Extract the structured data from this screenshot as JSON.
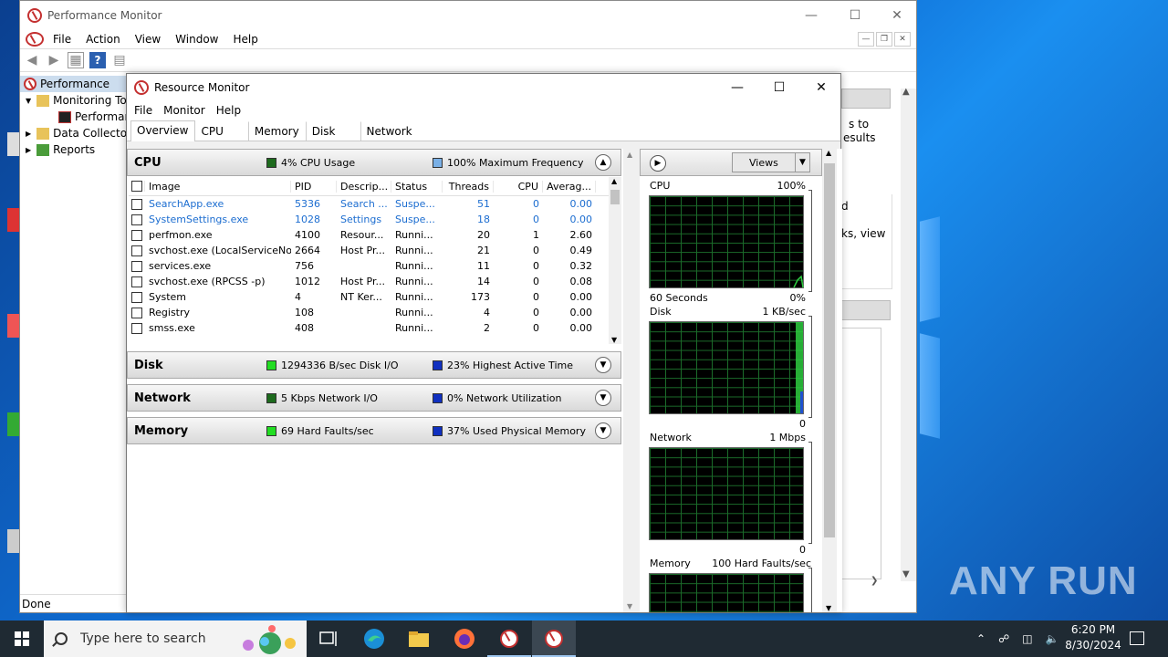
{
  "perfmon": {
    "title": "Performance Monitor",
    "menu": [
      "File",
      "Action",
      "View",
      "Window",
      "Help"
    ],
    "tree": [
      {
        "label": "Performance"
      },
      {
        "label": "Monitoring To"
      },
      {
        "label": "Performan"
      },
      {
        "label": "Data Collecto"
      },
      {
        "label": "Reports"
      }
    ],
    "status": "Done",
    "right_text": [
      "s to",
      "esults",
      "d",
      "ks, view"
    ]
  },
  "resmon": {
    "title": "Resource Monitor",
    "menu": [
      "File",
      "Monitor",
      "Help"
    ],
    "tabs": [
      "Overview",
      "CPU",
      "Memory",
      "Disk",
      "Network"
    ],
    "cpu": {
      "title": "CPU",
      "stat1": "4% CPU Usage",
      "stat1_color": "#1e6b1e",
      "stat2": "100% Maximum Frequency",
      "stat2_color": "#7ab0e6",
      "columns": [
        "Image",
        "PID",
        "Descrip...",
        "Status",
        "Threads",
        "CPU",
        "Averag..."
      ],
      "rows": [
        {
          "image": "SearchApp.exe",
          "pid": "5336",
          "desc": "Search ...",
          "status": "Suspe...",
          "threads": "51",
          "cpu": "0",
          "avg": "0.00"
        },
        {
          "image": "SystemSettings.exe",
          "pid": "1028",
          "desc": "Settings",
          "status": "Suspe...",
          "threads": "18",
          "cpu": "0",
          "avg": "0.00"
        },
        {
          "image": "perfmon.exe",
          "pid": "4100",
          "desc": "Resour...",
          "status": "Runni...",
          "threads": "20",
          "cpu": "1",
          "avg": "2.60"
        },
        {
          "image": "svchost.exe (LocalServiceNo...",
          "pid": "2664",
          "desc": "Host Pr...",
          "status": "Runni...",
          "threads": "21",
          "cpu": "0",
          "avg": "0.49"
        },
        {
          "image": "services.exe",
          "pid": "756",
          "desc": "",
          "status": "Runni...",
          "threads": "11",
          "cpu": "0",
          "avg": "0.32"
        },
        {
          "image": "svchost.exe (RPCSS -p)",
          "pid": "1012",
          "desc": "Host Pr...",
          "status": "Runni...",
          "threads": "14",
          "cpu": "0",
          "avg": "0.08"
        },
        {
          "image": "System",
          "pid": "4",
          "desc": "NT Ker...",
          "status": "Runni...",
          "threads": "173",
          "cpu": "0",
          "avg": "0.00"
        },
        {
          "image": "Registry",
          "pid": "108",
          "desc": "",
          "status": "Runni...",
          "threads": "4",
          "cpu": "0",
          "avg": "0.00"
        },
        {
          "image": "smss.exe",
          "pid": "408",
          "desc": "",
          "status": "Runni...",
          "threads": "2",
          "cpu": "0",
          "avg": "0.00"
        }
      ]
    },
    "disk": {
      "title": "Disk",
      "stat1": "1294336 B/sec Disk I/O",
      "stat1_color": "#22dd22",
      "stat2": "23% Highest Active Time",
      "stat2_color": "#1030c0"
    },
    "network": {
      "title": "Network",
      "stat1": "5 Kbps Network I/O",
      "stat1_color": "#1e6b1e",
      "stat2": "0% Network Utilization",
      "stat2_color": "#1030c0"
    },
    "memory": {
      "title": "Memory",
      "stat1": "69 Hard Faults/sec",
      "stat1_color": "#22dd22",
      "stat2": "37% Used Physical Memory",
      "stat2_color": "#1030c0"
    },
    "graphs": {
      "views_label": "Views",
      "cpu": {
        "name": "CPU",
        "max": "100%",
        "time": "60 Seconds",
        "min": "0%"
      },
      "disk": {
        "name": "Disk",
        "max": "1 KB/sec",
        "min": "0"
      },
      "network": {
        "name": "Network",
        "max": "1 Mbps",
        "min": "0"
      },
      "memory": {
        "name": "Memory",
        "max": "100 Hard Faults/sec"
      }
    }
  },
  "taskbar": {
    "search_placeholder": "Type here to search",
    "time": "6:20 PM",
    "date": "8/30/2024"
  },
  "watermark": "ANY RUN"
}
